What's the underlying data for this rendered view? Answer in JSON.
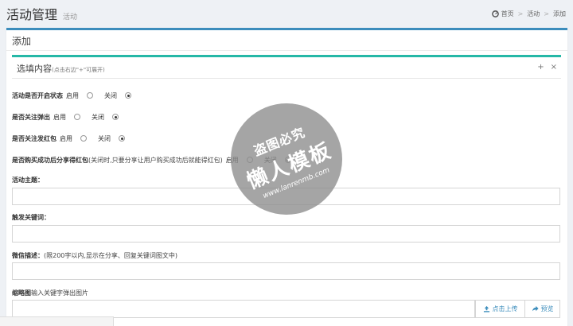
{
  "header": {
    "title": "活动管理",
    "subtitle": "活动",
    "breadcrumb": [
      "首页",
      "活动",
      "添加"
    ]
  },
  "outer_panel": {
    "title": "添加"
  },
  "inner_panel": {
    "title": "选填内容",
    "hint": "(点击右边\"+\"可展开)",
    "tools": {
      "expand": "+",
      "close": "×"
    }
  },
  "form": {
    "activity_status": {
      "label": "活动是否开启状态",
      "options": [
        "启用",
        "关闭"
      ],
      "selected": "关闭"
    },
    "follow_popup": {
      "label": "是否关注弹出",
      "options": [
        "启用",
        "关闭"
      ],
      "selected": "关闭"
    },
    "follow_red_packet": {
      "label": "是否关注发红包",
      "options": [
        "启用",
        "关闭"
      ],
      "selected": "关闭"
    },
    "share_red_packet": {
      "label": "是否购买成功后分享得红包",
      "note": "(关闭时,只要分享让用户购买成功后就能得红包)",
      "options": [
        "启用",
        "关闭"
      ],
      "selected": "关闭"
    },
    "activity_theme": {
      "label": "活动主题：",
      "value": ""
    },
    "trigger_keyword": {
      "label": "触发关键词：",
      "value": ""
    },
    "wechat_desc": {
      "label": "微信描述：",
      "note": "(限200字以内,显示在分享、回复关键词图文中)",
      "value": ""
    },
    "thumbnail": {
      "label": "缩略图",
      "note": "输入关键字弹出图片",
      "value": "",
      "upload_label": "点击上传",
      "preview_label": "预览"
    }
  },
  "watermark": {
    "top": "盗图必究",
    "big": "懒人模板",
    "url": "www.lanrenmb.com"
  },
  "colors": {
    "primary": "#3c8dbc",
    "teal": "#26b8a7"
  }
}
